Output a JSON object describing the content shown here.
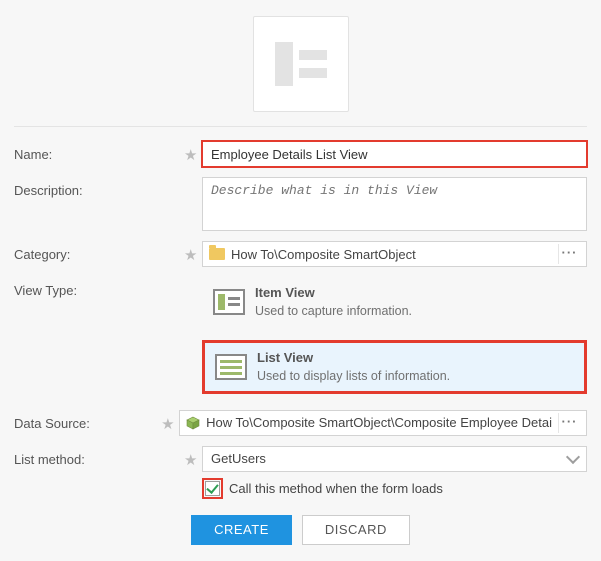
{
  "labels": {
    "name": "Name:",
    "description": "Description:",
    "category": "Category:",
    "view_type": "View Type:",
    "data_source": "Data Source:",
    "list_method": "List method:"
  },
  "fields": {
    "name_value": "Employee Details List View",
    "description_placeholder": "Describe what is in this View",
    "category_value": "How To\\Composite SmartObject",
    "data_source_value": "How To\\Composite SmartObject\\Composite Employee Detai",
    "list_method_value": "GetUsers",
    "call_method_label": "Call this method when the form loads"
  },
  "view_types": {
    "item": {
      "title": "Item View",
      "desc": "Used to capture information."
    },
    "list": {
      "title": "List View",
      "desc": "Used to display lists of information."
    }
  },
  "buttons": {
    "create": "CREATE",
    "discard": "DISCARD"
  },
  "picker": {
    "browse": "···"
  }
}
